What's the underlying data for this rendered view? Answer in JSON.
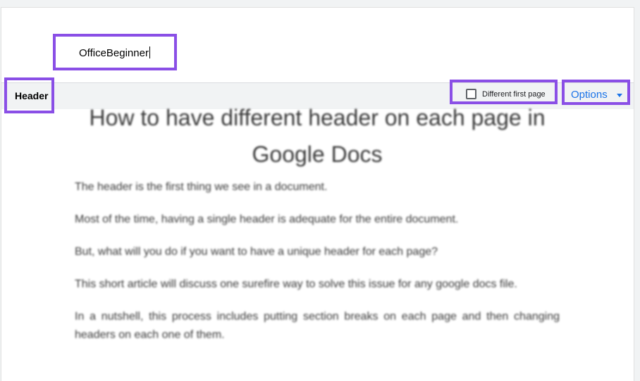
{
  "header_text": "OfficeBeginner",
  "header_label": "Header",
  "different_first_page": {
    "label": "Different first page",
    "checked": false
  },
  "options_label": "Options",
  "document": {
    "title": "How to have different header on each page in Google Docs",
    "paragraphs": [
      "The header is the first thing we see in a document.",
      "Most of the time, having a single header is adequate for the entire document.",
      "But, what will you do if you want to have a unique header for each page?",
      "This short article will discuss one surefire way to solve this issue for any google docs file.",
      "In a nutshell, this process includes putting section breaks on each page and then changing headers on each one of them."
    ]
  },
  "colors": {
    "highlight_border": "#8a4fe6",
    "options_link": "#1a73e8"
  },
  "icons": {
    "checkbox": "checkbox-unchecked-icon",
    "dropdown": "arrow-drop-down-icon"
  }
}
